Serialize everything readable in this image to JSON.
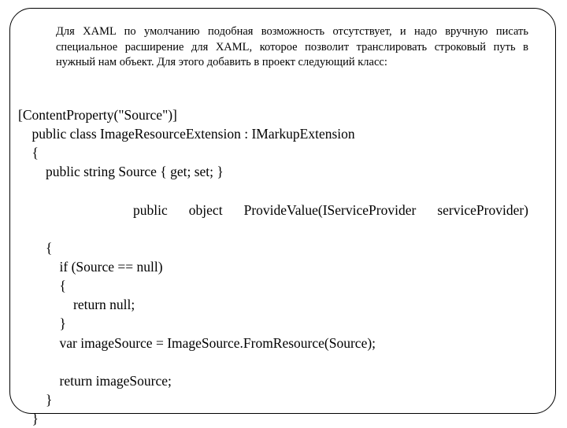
{
  "intro": "Для XAML по умолчанию подобная возможность отсутствует, и надо вручную писать специальное расширение для XAML, которое позволит транслировать строковый путь в нужный нам объект. Для этого добавить в проект следующий класс:",
  "code": {
    "l1": "[ContentProperty(\"Source\")]",
    "l2": "    public class ImageResourceExtension : IMarkupExtension",
    "l3": "    {",
    "l4": "        public string Source { get; set; }",
    "l5": "",
    "sig": "public object ProvideValue(IServiceProvider serviceProvider)",
    "l7": "        {",
    "l8": "            if (Source == null)",
    "l9": "            {",
    "l10": "                return null;",
    "l11": "            }",
    "l12": "            var imageSource = ImageSource.FromResource(Source);",
    "l13": "",
    "l14": "            return imageSource;",
    "l15": "        }",
    "l16": "    }"
  }
}
